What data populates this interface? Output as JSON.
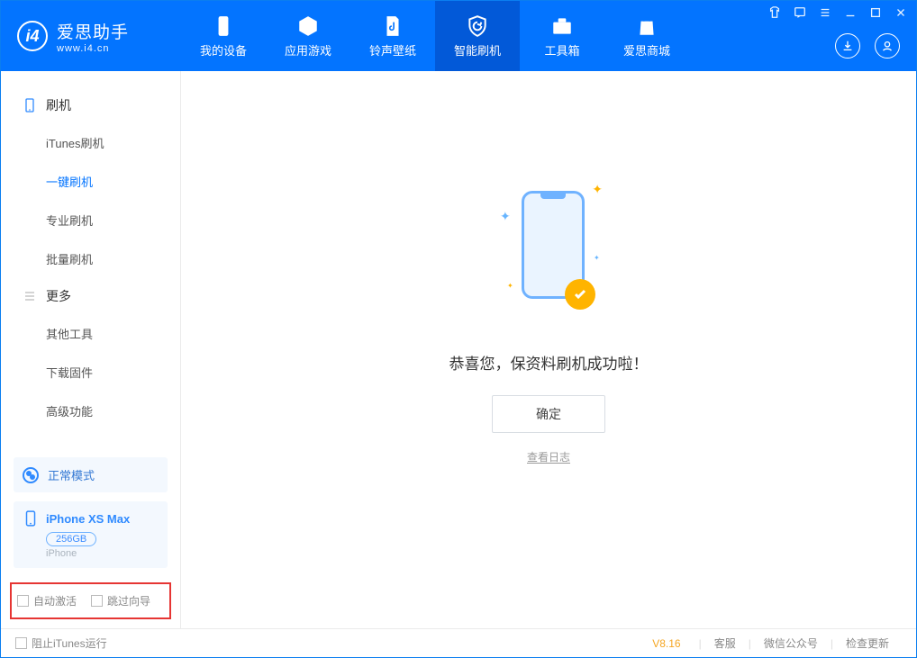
{
  "app": {
    "name_cn": "爱思助手",
    "name_en": "www.i4.cn"
  },
  "tabs": [
    {
      "label": "我的设备"
    },
    {
      "label": "应用游戏"
    },
    {
      "label": "铃声壁纸"
    },
    {
      "label": "智能刷机"
    },
    {
      "label": "工具箱"
    },
    {
      "label": "爱思商城"
    }
  ],
  "sidebar": {
    "group1_title": "刷机",
    "group1_items": [
      "iTunes刷机",
      "一键刷机",
      "专业刷机",
      "批量刷机"
    ],
    "group2_title": "更多",
    "group2_items": [
      "其他工具",
      "下载固件",
      "高级功能"
    ]
  },
  "mode": {
    "label": "正常模式"
  },
  "device": {
    "name": "iPhone XS Max",
    "capacity": "256GB",
    "type": "iPhone"
  },
  "options": {
    "auto_activate": "自动激活",
    "skip_guide": "跳过向导"
  },
  "main": {
    "success": "恭喜您，保资料刷机成功啦！",
    "ok": "确定",
    "view_log": "查看日志"
  },
  "footer": {
    "block_itunes": "阻止iTunes运行",
    "version": "V8.16",
    "links": [
      "客服",
      "微信公众号",
      "检查更新"
    ]
  }
}
